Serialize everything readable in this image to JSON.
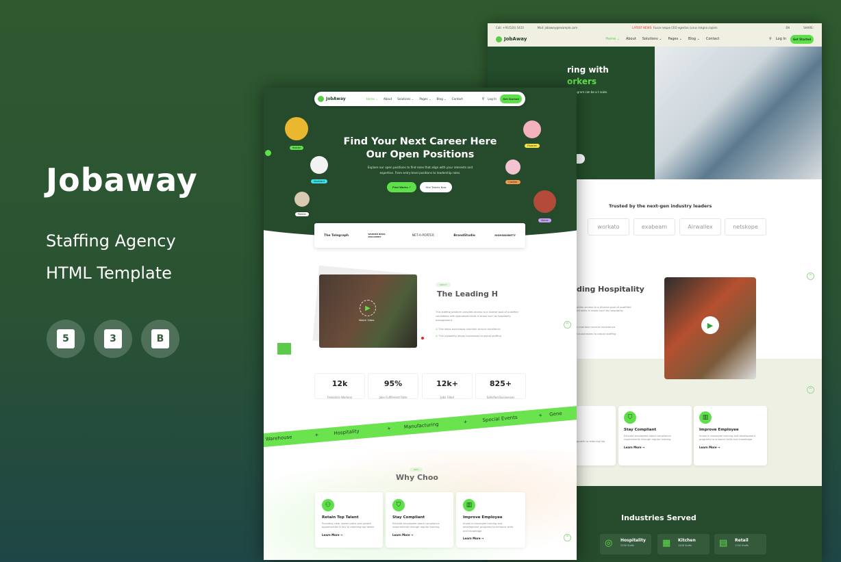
{
  "promo": {
    "title": "Jobaway",
    "subtitle1": "Staffing Agency",
    "subtitle2": "HTML Template",
    "tech_icons": [
      "html5-icon",
      "css3-icon",
      "bootstrap-icon"
    ],
    "tech_labels": [
      "5",
      "3",
      "B"
    ]
  },
  "colors": {
    "accent": "#5fe04a",
    "dark_green": "#254a2c",
    "cream": "#efefe2"
  },
  "back_page": {
    "topbar": {
      "call": "Call: +91(520) 5433",
      "mail": "Mail: jobaway@example.com",
      "news_label": "LATEST NEWS:",
      "news": "Fusce neque CEO egestas curus magna sapien",
      "lang": "EN",
      "share": "SHARE:"
    },
    "nav": {
      "logo": "JobAway",
      "links": [
        "Home ⌄",
        "About",
        "Solutions ⌄",
        "Pages ⌄",
        "Blog ⌄",
        "Contact"
      ],
      "login": "Log In",
      "cta": "Get Started"
    },
    "hero": {
      "title1": "ring with",
      "title2": "orkers",
      "text": "rral program can be a t scale."
    },
    "trusted": {
      "title": "Trusted by the next-gen industry leaders",
      "logos": [
        "workato",
        "exabeam",
        "Airwallex",
        "netskope"
      ]
    },
    "about": {
      "title": "ding Hospitality",
      "text": "vides access to a diverse pool of qualified ed skills in areas such as hospitality",
      "points": [
        "s maintain service excellence",
        "s businesses to adjust staffing"
      ]
    },
    "cards": [
      {
        "title": "ent",
        "text": "r paths and growth to retaining top talent"
      },
      {
        "title": "Stay Compliant",
        "text": "Educate employees about compliance requirements through regular training",
        "link": "Learn More →"
      },
      {
        "title": "Improve Employee",
        "text": "Invest in employee training and development programs to enhance skills and knowledge",
        "link": "Learn More →"
      }
    ],
    "ribbon_word": "Gene",
    "industries": {
      "title": "Industries Served",
      "items": [
        {
          "name": "Hospitality",
          "count": "2258 Staffs"
        },
        {
          "name": "Kitchen",
          "count": "1408 Staffs"
        },
        {
          "name": "Retail",
          "count": "1740 Staffs"
        }
      ]
    }
  },
  "front_page": {
    "nav": {
      "logo": "JobAway",
      "links": [
        "Home ⌄",
        "About",
        "Solutions ⌄",
        "Pages ⌄",
        "Blog ⌄",
        "Contact"
      ],
      "login": "Log In",
      "cta": "Get Started"
    },
    "hero": {
      "title1": "Find Your Next Career Here",
      "title2": "Our Open Positions",
      "text": "Explore our open positions to find roles that align with your interests and expertise. From entry-level positions to leadership roles.",
      "btn_primary": "Find Works ↗",
      "btn_secondary": "Hire Talents Now"
    },
    "avatars": [
      "Hostler",
      "Assistant",
      "Painter",
      "Finance",
      "Cashier",
      "Nurse"
    ],
    "logos": [
      "The Telegraph",
      "WARNER BROS. DISCOVERY",
      "NET-A-PORTER",
      "BrandStudio",
      "HIGHSNOBIETY"
    ],
    "about": {
      "badge": "ABOUT",
      "title": "The Leading H",
      "video": "Watch Video",
      "text": "This staffing platform provides access to a diverse pool of qualified candidates with specialized skills in areas such as hospitality management.",
      "points": [
        "This helps businesses maintain service excellence",
        "This scalability allows businesses to adjust staffing"
      ]
    },
    "stats": [
      {
        "value": "12k",
        "label": "Freelance Workers"
      },
      {
        "value": "95%",
        "label": "Jobs Fulfillment Rate"
      },
      {
        "value": "12k+",
        "label": "Jobs Filled"
      },
      {
        "value": "825+",
        "label": "Satisfied Businesses"
      }
    ],
    "ribbon": [
      "Warehouse",
      "Hospitality",
      "Manufacturing",
      "Special Events",
      "Gene"
    ],
    "why": {
      "badge": "WHY",
      "title": "Why Choo"
    },
    "cards": [
      {
        "title": "Retain Top Talent",
        "text": "Providing clear career paths and growth opportunities is key to retaining top talent.",
        "link": "Learn More →"
      },
      {
        "title": "Stay Compliant",
        "text": "Educate employees about compliance requirements through regular training",
        "link": "Learn More →"
      },
      {
        "title": "Improve Employee",
        "text": "Invest in employee training and development programs to enhance skills and knowledge",
        "link": "Learn More →"
      }
    ]
  }
}
